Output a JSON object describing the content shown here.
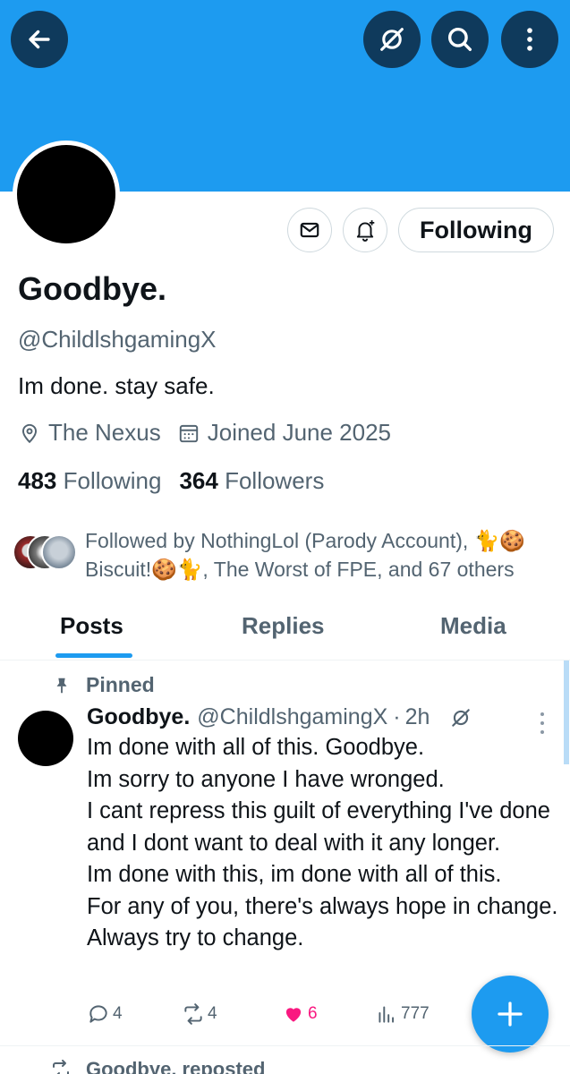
{
  "header": {
    "back_icon": "arrow-left-icon",
    "grok_icon": "grok-icon",
    "search_icon": "search-icon",
    "more_icon": "more-vertical-icon",
    "banner_color": "#1d9bf0"
  },
  "profile": {
    "name": "Goodbye.",
    "handle": "@ChildlshgamingX",
    "bio": "Im done. stay safe.",
    "location": "The Nexus",
    "joined": "Joined June 2025",
    "following_count": "483",
    "following_label": "Following",
    "followers_count": "364",
    "followers_label": "Followers",
    "follow_button": "Following"
  },
  "followed_by": {
    "text": "Followed by NothingLol (Parody Account), 🐈🍪Biscuit!🍪🐈, The Worst of FPE, and 67 others"
  },
  "tabs": {
    "posts": "Posts",
    "replies": "Replies",
    "media": "Media",
    "active": "Posts"
  },
  "pinned_post": {
    "pinned_label": "Pinned",
    "author_name": "Goodbye.",
    "author_handle": "@ChildlshgamingX",
    "separator": "·",
    "time": "2h",
    "text": "Im done with all of this. Goodbye.\nIm sorry to anyone I have wronged.\nI cant repress this guilt of everything I've done and I dont want to deal with it any longer.\nIm done with this, im done with all of this.\nFor any of you, there's always hope in change. Always try to change.",
    "replies": "4",
    "reposts": "4",
    "likes": "6",
    "views": "777",
    "like_color": "#f91880"
  },
  "next_post": {
    "repost_label": "Goodbye. reposted"
  },
  "accent_color": "#1d9bf0"
}
